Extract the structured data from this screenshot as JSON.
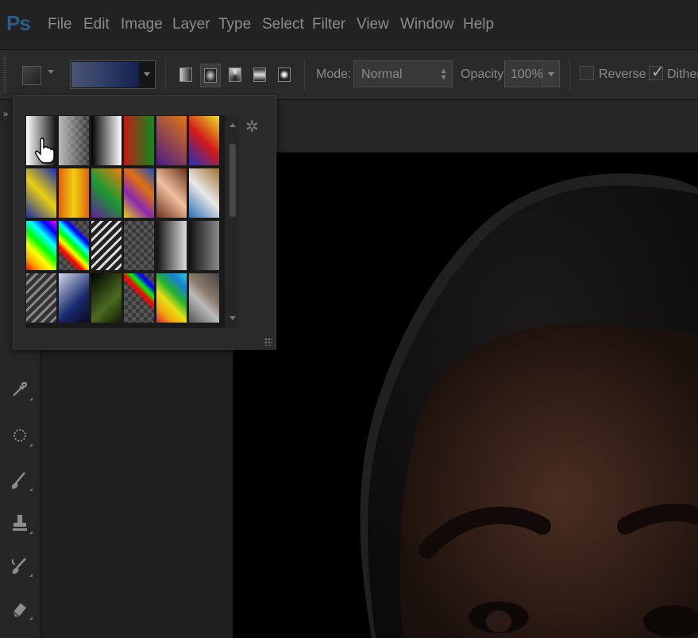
{
  "app": {
    "logo": "Ps"
  },
  "menu": [
    "File",
    "Edit",
    "Image",
    "Layer",
    "Type",
    "Select",
    "Filter",
    "View",
    "Window",
    "Help"
  ],
  "options": {
    "mode_label": "Mode:",
    "mode_value": "Normal",
    "opacity_label": "Opacity:",
    "opacity_value": "100%",
    "reverse_label": "Reverse",
    "reverse_checked": false,
    "dither_label": "Dither",
    "dither_checked": true,
    "gradient_types": [
      "linear",
      "radial",
      "angle",
      "reflected",
      "diamond"
    ],
    "active_gradient_type": "radial"
  },
  "gradient_picker": {
    "presets": [
      "foreground-to-background",
      "foreground-to-transparent",
      "black-white",
      "red-green",
      "violet-orange",
      "blue-red-yellow",
      "blue-yellow-blue",
      "orange-yellow-orange",
      "violet-green-orange",
      "yellow-violet-orange-blue",
      "copper",
      "chrome",
      "spectrum",
      "transparent-rainbow",
      "transparent-stripes",
      "transparent-checker",
      "neutral-density",
      "black-gray",
      "gray-stripes",
      "blue-black",
      "green-black",
      "checker-rainbow",
      "rainbow",
      "silver-gray"
    ]
  },
  "tools": [
    "eyedropper-tool",
    "healing-brush-tool",
    "brush-tool",
    "clone-stamp-tool",
    "history-brush-tool",
    "eraser-tool"
  ],
  "colors": {
    "menubar": "#222222",
    "options_bar": "#2a2a2a",
    "panel": "#2b2b2b",
    "canvas": "#000000",
    "logo": "#2b5d86"
  }
}
